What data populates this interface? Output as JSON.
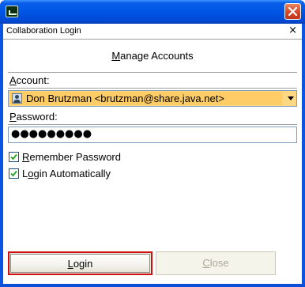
{
  "window": {
    "titlebar_icon": "java-app-icon",
    "close_icon": "close-icon"
  },
  "dialog": {
    "title": "Collaboration Login",
    "close_glyph": "×"
  },
  "manage_accounts": {
    "label_prefix": "",
    "mnemonic": "M",
    "label_rest": "anage Accounts"
  },
  "account": {
    "label_mnemonic": "A",
    "label_rest": "ccount:",
    "selected_value": "Don Brutzman <brutzman@share.java.net>",
    "icon": "user-account-icon"
  },
  "password": {
    "label_mnemonic": "P",
    "label_rest": "assword:",
    "masked_value": "●●●●●●●●●"
  },
  "options": {
    "remember": {
      "mnemonic": "R",
      "label_rest": "emember Password",
      "checked": true
    },
    "auto_login": {
      "label_prefix": "L",
      "mnemonic": "o",
      "label_rest": "gin Automatically",
      "checked": true
    }
  },
  "buttons": {
    "login": {
      "mnemonic": "L",
      "label_rest": "ogin"
    },
    "close": {
      "mnemonic": "C",
      "label_rest": "lose",
      "enabled": false
    }
  },
  "colors": {
    "titlebar": "#0055e5",
    "focus_border": "#d01010",
    "combo_selected": "#ffcc66"
  }
}
